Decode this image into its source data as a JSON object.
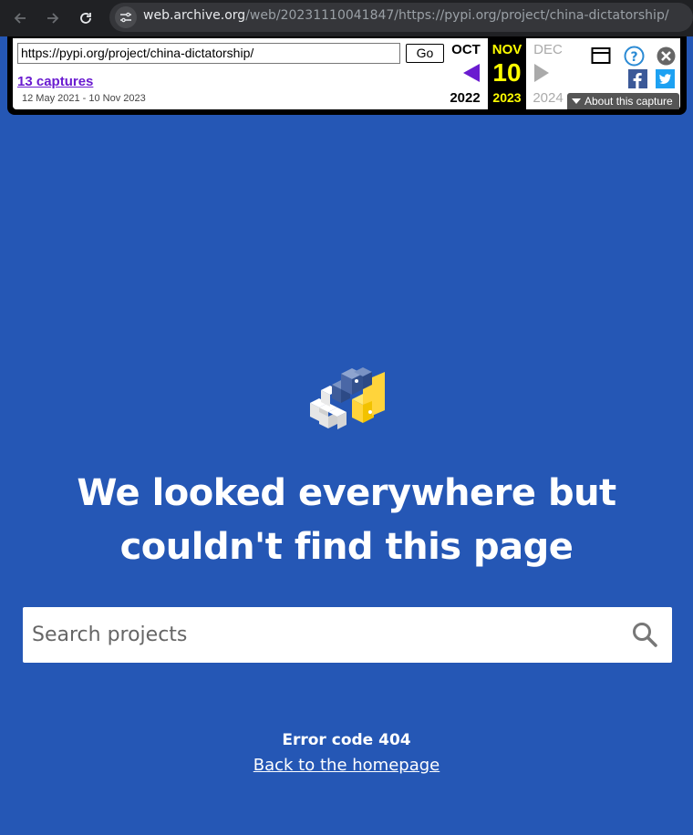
{
  "browser": {
    "url_host": "web.archive.org",
    "url_path": "/web/20231110041847/https://pypi.org/project/china-dictatorship/"
  },
  "wayback": {
    "url_value": "https://pypi.org/project/china-dictatorship/",
    "go_label": "Go",
    "captures_label": "13 captures",
    "capture_range": "12 May 2021 - 10 Nov 2023",
    "prev_month": "OCT",
    "cur_month": "NOV",
    "next_month": "DEC",
    "cur_day": "10",
    "prev_year": "2022",
    "cur_year": "2023",
    "next_year": "2024",
    "about_label": "About this capture",
    "colors": {
      "current_bg": "#000000",
      "current_text": "#ffff00",
      "link": "#6a1bd0"
    }
  },
  "page": {
    "headline": "We looked everywhere but couldn't find this page",
    "search_placeholder": "Search projects",
    "error_code": "Error code 404",
    "home_link": "Back to the homepage",
    "colors": {
      "background": "#2557b5",
      "text": "#ffffff"
    }
  }
}
